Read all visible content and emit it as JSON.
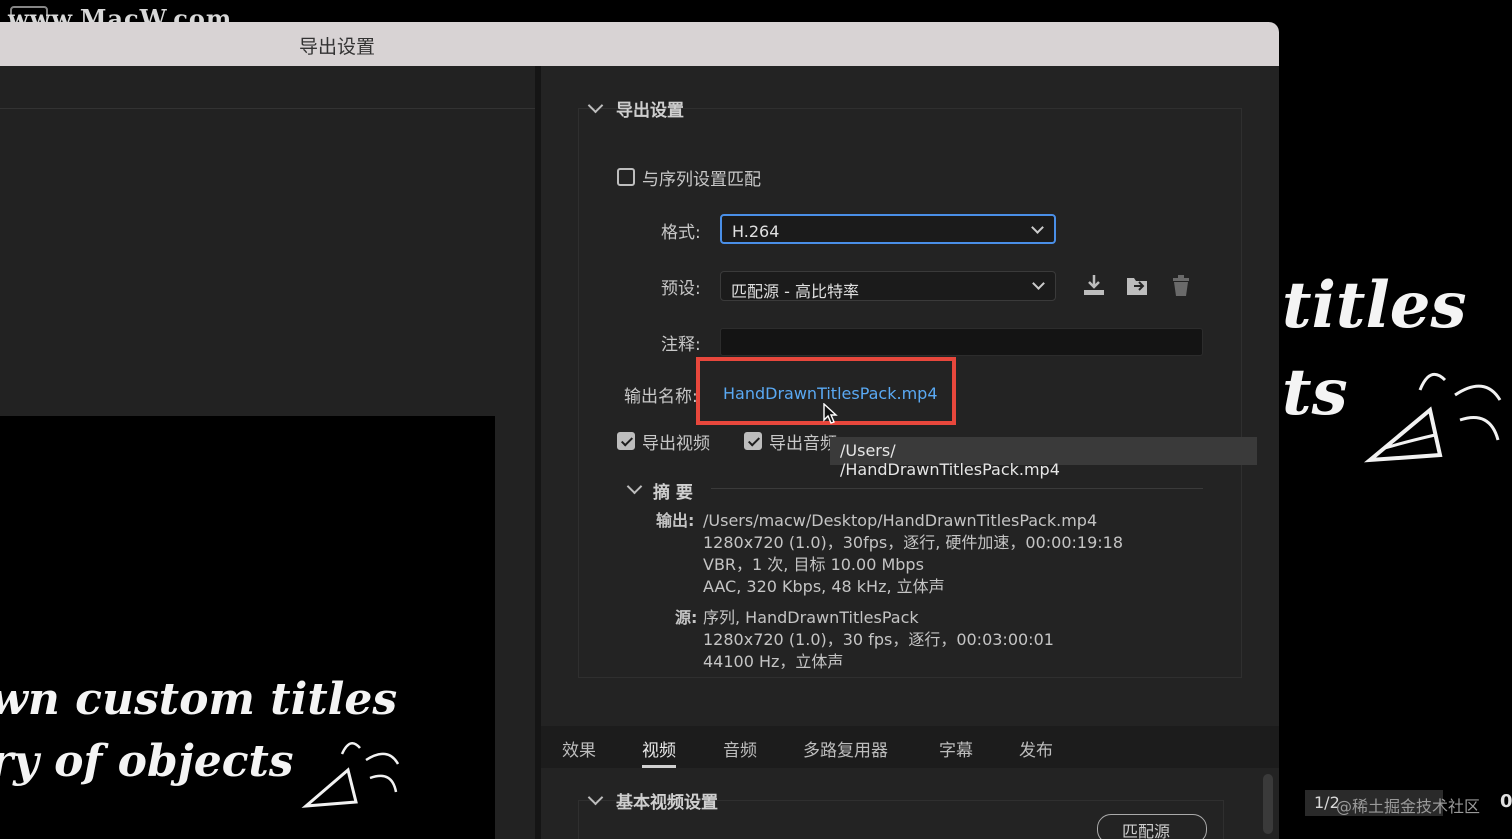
{
  "watermark": {
    "text": "www.MacW.com"
  },
  "dialog": {
    "title": "导出设置"
  },
  "export_settings": {
    "section_title": "导出设置",
    "match_sequence_label": "与序列设置匹配",
    "format_label": "格式:",
    "format_value": "H.264",
    "preset_label": "预设:",
    "preset_value": "匹配源 - 高比特率",
    "comment_label": "注释:",
    "comment_value": "",
    "output_name_label": "输出名称:",
    "output_name_value": "HandDrawnTitlesPack.mp4",
    "tooltip_prefix": "/Users/",
    "tooltip_suffix": "/HandDrawnTitlesPack.mp4",
    "export_video_label": "导出视频",
    "export_audio_label": "导出音频"
  },
  "summary": {
    "title": "摘 要",
    "output_label": "输出:",
    "output_lines": [
      "/Users/macw/Desktop/HandDrawnTitlesPack.mp4",
      "1280x720 (1.0)，30fps，逐行, 硬件加速，00:00:19:18",
      "VBR，1 次, 目标 10.00 Mbps",
      "AAC, 320 Kbps, 48  kHz, 立体声"
    ],
    "source_label": "源:",
    "source_lines": [
      "序列, HandDrawnTitlesPack",
      "1280x720 (1.0)，30 fps，逐行，00:03:00:01",
      "44100 Hz，立体声"
    ]
  },
  "tabs": [
    {
      "label": "效果",
      "active": false
    },
    {
      "label": "视频",
      "active": true
    },
    {
      "label": "音频",
      "active": false
    },
    {
      "label": "多路复用器",
      "active": false
    },
    {
      "label": "字幕",
      "active": false
    },
    {
      "label": "发布",
      "active": false
    }
  ],
  "basic_video": {
    "section_title": "基本视频设置",
    "match_source_button": "匹配源"
  },
  "preview_left": {
    "line1": "wn custom titles",
    "line2": "ry of objects"
  },
  "preview_right": {
    "line1": "titles",
    "line2": "ts"
  },
  "bottom_right": {
    "page": "1/2",
    "brand": "@稀土掘金技术社区",
    "trailing": "0"
  },
  "colors": {
    "accent_link": "#5aa9f3",
    "focus_border": "#4a8fe7",
    "highlight_box": "#e8473c"
  }
}
